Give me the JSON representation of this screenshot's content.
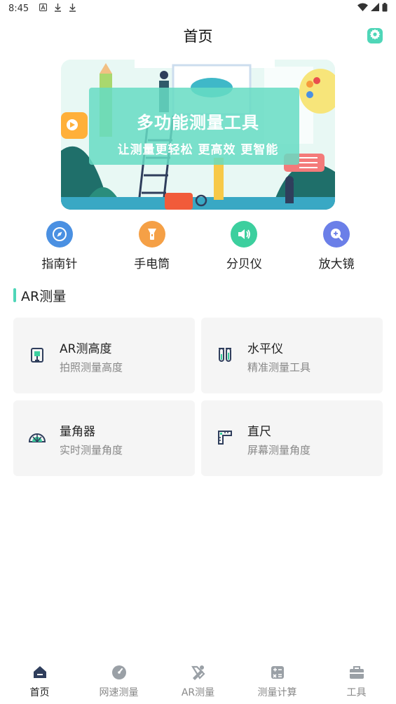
{
  "status_bar": {
    "time": "8:45",
    "icons": [
      "a-icon",
      "download-icon",
      "download-icon"
    ],
    "right_icons": [
      "wifi-icon",
      "signal-icon",
      "battery-icon"
    ]
  },
  "header": {
    "title": "首页",
    "settings_icon": "gear-icon",
    "accent_color": "#4fd6b8"
  },
  "banner": {
    "headline": "多功能测量工具",
    "subline": "让测量更轻松 更高效 更智能"
  },
  "quick_tools": [
    {
      "label": "指南针",
      "icon": "compass-icon",
      "color": "#4a90e2"
    },
    {
      "label": "手电筒",
      "icon": "flashlight-icon",
      "color": "#f5a046"
    },
    {
      "label": "分贝仪",
      "icon": "speaker-icon",
      "color": "#3ccf9e"
    },
    {
      "label": "放大镜",
      "icon": "magnifier-icon",
      "color": "#6b7fe8"
    }
  ],
  "section": {
    "title": "AR测量"
  },
  "cards": [
    {
      "title": "AR测高度",
      "subtitle": "拍照测量高度",
      "icon": "height-icon"
    },
    {
      "title": "水平仪",
      "subtitle": "精准测量工具",
      "icon": "level-icon"
    },
    {
      "title": "量角器",
      "subtitle": "实时测量角度",
      "icon": "protractor-icon"
    },
    {
      "title": "直尺",
      "subtitle": "屏幕测量角度",
      "icon": "ruler-icon"
    }
  ],
  "bottom_nav": [
    {
      "label": "首页",
      "icon": "home-icon",
      "active": true
    },
    {
      "label": "网速测量",
      "icon": "speedometer-icon",
      "active": false
    },
    {
      "label": "AR测量",
      "icon": "ar-tools-icon",
      "active": false
    },
    {
      "label": "测量计算",
      "icon": "calculator-icon",
      "active": false
    },
    {
      "label": "工具",
      "icon": "toolbox-icon",
      "active": false
    }
  ]
}
